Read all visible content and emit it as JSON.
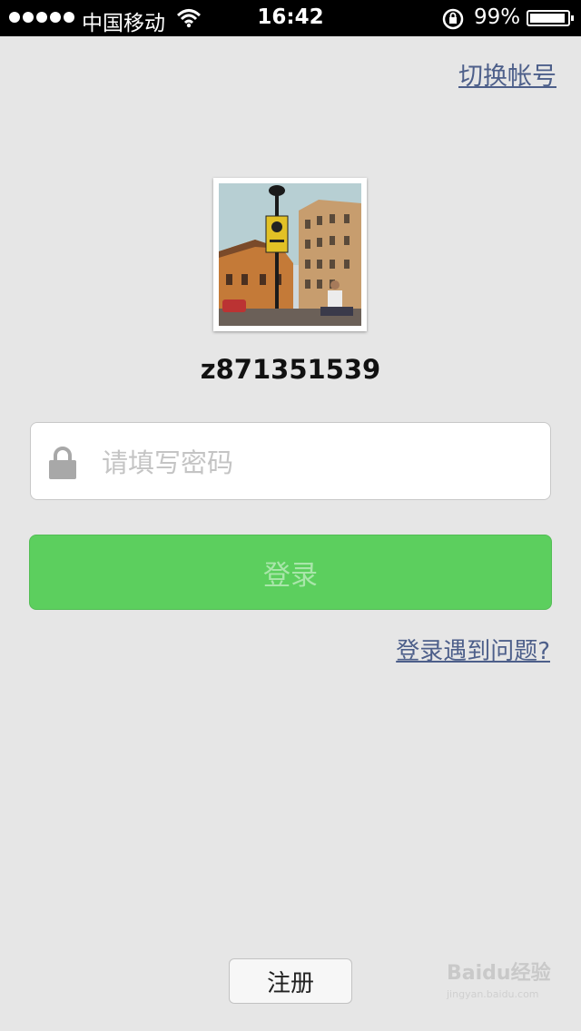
{
  "status_bar": {
    "carrier": "中国移动",
    "time": "16:42",
    "battery": "99%",
    "battery_level": 0.99
  },
  "header": {
    "switch_account": "切换帐号"
  },
  "account": {
    "username": "z871351539"
  },
  "password": {
    "placeholder": "请填写密码",
    "value": ""
  },
  "login_button": "登录",
  "login_problem": "登录遇到问题?",
  "register_button": "注册",
  "watermark": {
    "brand": "Baidu经验",
    "url": "jingyan.baidu.com"
  },
  "icons": [
    "signal-dots-icon",
    "wifi-icon",
    "rotation-lock-icon",
    "battery-icon",
    "lock-icon"
  ],
  "colors": {
    "accent_green": "#5ccf5e",
    "link_blue": "#4d5f8a",
    "background": "#e6e6e6"
  }
}
